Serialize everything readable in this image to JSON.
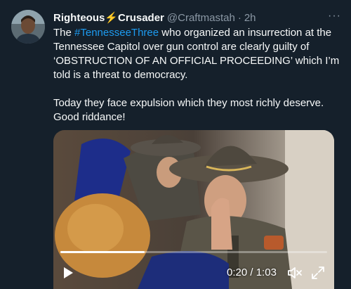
{
  "tweet": {
    "display_name": "Righteous",
    "display_name_suffix": "Crusader",
    "name_emoji": "⚡",
    "handle": "@Craftmastah",
    "separator": "·",
    "time": "2h",
    "more_label": "···",
    "text_before_hashtag": "The ",
    "hashtag": "#TennesseeThree",
    "text_after_hashtag": " who organized an insurrection at the Tennessee Capitol over gun control are clearly guilty of ‘OBSTRUCTION OF AN OFFICIAL PROCEEDING’ which I’m told is a threat to democracy.",
    "paragraph_2": "Today they face expulsion which they most richly deserve. Good riddance!"
  },
  "video": {
    "current_time": "0:20",
    "duration": "1:03",
    "time_separator": " / ",
    "progress_fraction": 0.317,
    "controls": {
      "play_icon": "play-icon",
      "mute_icon": "muted-speaker-icon",
      "expand_icon": "expand-icon"
    }
  },
  "colors": {
    "background": "#15202b",
    "text": "#f7f9f9",
    "secondary_text": "#8b98a5",
    "hashtag": "#1d9bf0",
    "bolt": "#f5a623"
  }
}
